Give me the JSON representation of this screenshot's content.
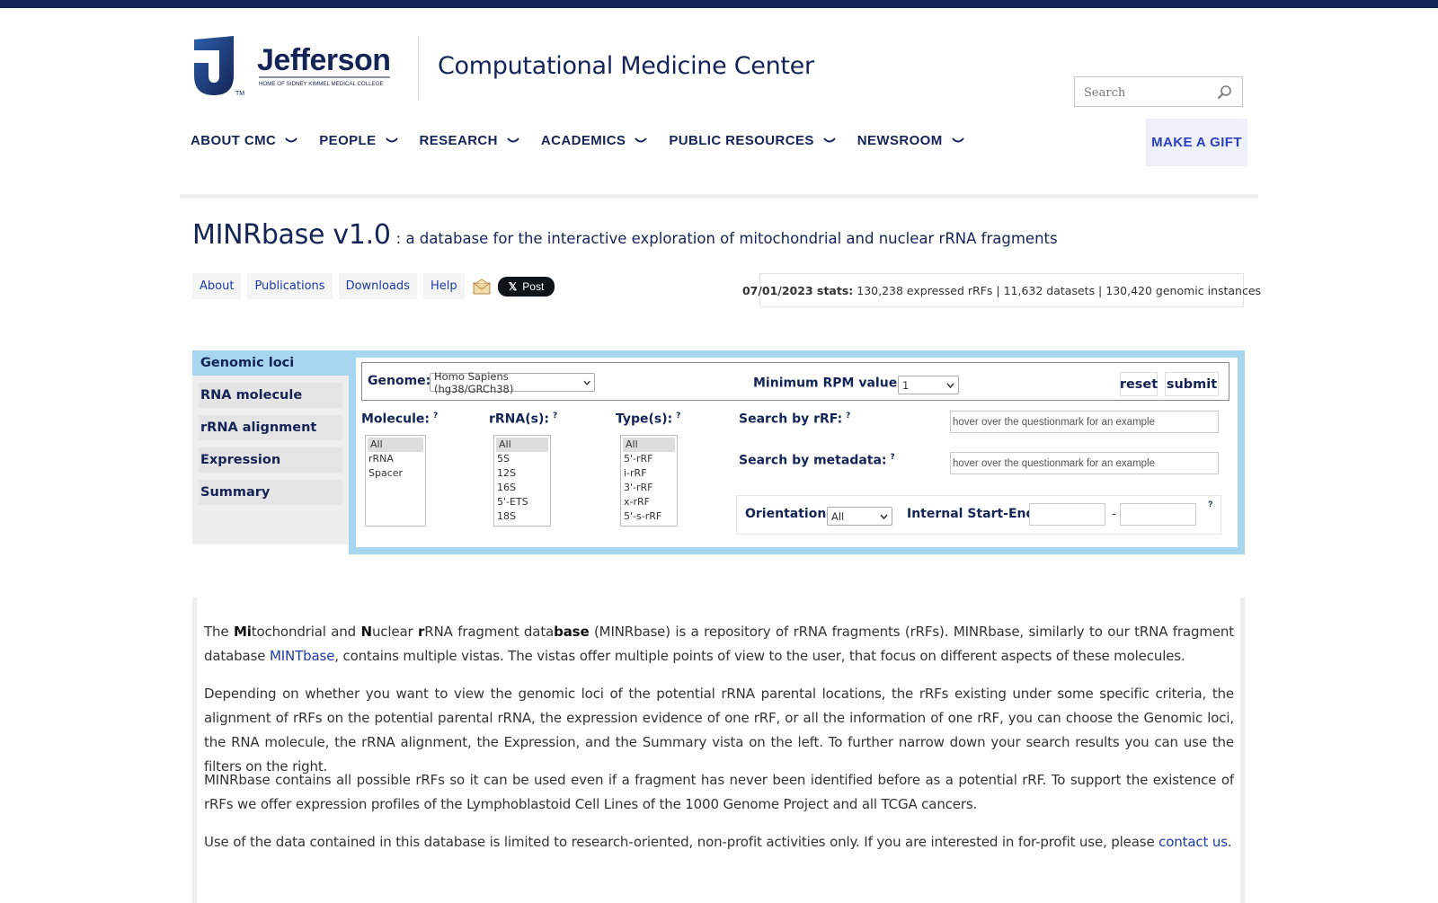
{
  "header": {
    "logo_text": "Jefferson",
    "logo_tagline": "HOME OF SIDNEY KIMMEL MEDICAL COLLEGE",
    "logo_tm": "TM",
    "site_title": "Computational Medicine Center",
    "search_placeholder": "Search"
  },
  "nav": {
    "items": [
      {
        "label": "ABOUT CMC"
      },
      {
        "label": "PEOPLE"
      },
      {
        "label": "RESEARCH"
      },
      {
        "label": "ACADEMICS"
      },
      {
        "label": "PUBLIC RESOURCES"
      },
      {
        "label": "NEWSROOM"
      }
    ],
    "gift_label": "MAKE A GIFT"
  },
  "page": {
    "title": "MINRbase v1.0",
    "subtitle": ": a database for the interactive exploration of mitochondrial and nuclear rRNA fragments"
  },
  "subnav": {
    "links": [
      "About",
      "Publications",
      "Downloads",
      "Help"
    ],
    "x_post_label": "Post"
  },
  "stats": {
    "date_label": "07/01/2023 stats:",
    "text": "130,238 expressed rRFs | 11,632 datasets | 130,420 genomic instances"
  },
  "sidebar": {
    "items": [
      "Genomic loci",
      "RNA molecule",
      "rRNA alignment",
      "Expression",
      "Summary"
    ]
  },
  "filters": {
    "genome_label": "Genome:",
    "genome_value": "Homo Sapiens (hg38/GRCh38)",
    "min_rpm_label": "Minimum RPM value:",
    "min_rpm_value": "1",
    "reset_label": "reset",
    "submit_label": "submit",
    "help_mark": "?",
    "molecule_label": "Molecule:",
    "molecule_options": [
      "All",
      "rRNA",
      "Spacer"
    ],
    "rrna_label": "rRNA(s):",
    "rrna_options": [
      "All",
      "5S",
      "12S",
      "16S",
      "5'-ETS",
      "18S"
    ],
    "type_label": "Type(s):",
    "type_options": [
      "All",
      "5'-rRF",
      "i-rRF",
      "3'-rRF",
      "x-rRF",
      "5'-s-rRF"
    ],
    "search_rrf_label": "Search by rRF:",
    "search_rrf_placeholder": "hover over the questionmark for an example",
    "search_meta_label": "Search by metadata:",
    "search_meta_placeholder": "hover over the questionmark for an example",
    "orientation_label": "Orientation:",
    "orientation_value": "All",
    "internal_label": "Internal Start-End:",
    "range_dash": "-"
  },
  "content": {
    "p1_the": "The ",
    "p1_mi": "Mi",
    "p1_tochondrial": "tochondrial and ",
    "p1_n": "N",
    "p1_uclear": "uclear ",
    "p1_r": "r",
    "p1_rna": "RNA fragment data",
    "p1_base": "base",
    "p1_rest": " (MINRbase) is a repository of rRNA fragments (rRFs). MINRbase, similarly to our tRNA fragment database ",
    "p1_link": "MINTbase",
    "p1_end": ", contains multiple vistas. The vistas offer multiple points of view to the user, that focus on different aspects of these molecules.",
    "p2": "Depending on whether you want to view the genomic loci of the potential rRNA parental locations, the rRFs existing under some specific criteria, the alignment of rRFs on the potential parental rRNA, the expression evidence of one rRF, or all the information of one rRF, you can choose the Genomic loci, the RNA molecule, the rRNA alignment, the Expression, and the Summary vista on the left. To further narrow down your search results you can use the filters on the right.",
    "p3": "MINRbase contains all possible rRFs so it can be used even if a fragment has never been identified before as a potential rRF. To support the existence of rRFs we offer expression profiles of the Lymphoblastoid Cell Lines of the 1000 Genome Project and all TCGA cancers.",
    "p4_start": "Use of the data contained in this database is limited to research-oriented, non-profit activities only. If you are interested in for-profit use, please ",
    "p4_link": "contact us",
    "p4_end": "."
  },
  "colors": {
    "navy": "#152456",
    "link_blue": "#1f3aa4",
    "filter_panel_blue": "#a8d5ef",
    "topbar": "#152456",
    "logo_blue": "#2a5ea8"
  }
}
